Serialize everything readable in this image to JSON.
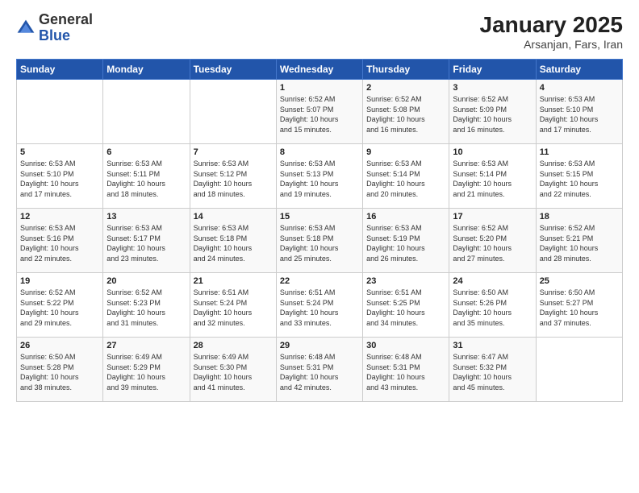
{
  "logo": {
    "general": "General",
    "blue": "Blue"
  },
  "title": "January 2025",
  "subtitle": "Arsanjan, Fars, Iran",
  "weekdays": [
    "Sunday",
    "Monday",
    "Tuesday",
    "Wednesday",
    "Thursday",
    "Friday",
    "Saturday"
  ],
  "weeks": [
    [
      {
        "day": "",
        "info": ""
      },
      {
        "day": "",
        "info": ""
      },
      {
        "day": "",
        "info": ""
      },
      {
        "day": "1",
        "info": "Sunrise: 6:52 AM\nSunset: 5:07 PM\nDaylight: 10 hours\nand 15 minutes."
      },
      {
        "day": "2",
        "info": "Sunrise: 6:52 AM\nSunset: 5:08 PM\nDaylight: 10 hours\nand 16 minutes."
      },
      {
        "day": "3",
        "info": "Sunrise: 6:52 AM\nSunset: 5:09 PM\nDaylight: 10 hours\nand 16 minutes."
      },
      {
        "day": "4",
        "info": "Sunrise: 6:53 AM\nSunset: 5:10 PM\nDaylight: 10 hours\nand 17 minutes."
      }
    ],
    [
      {
        "day": "5",
        "info": "Sunrise: 6:53 AM\nSunset: 5:10 PM\nDaylight: 10 hours\nand 17 minutes."
      },
      {
        "day": "6",
        "info": "Sunrise: 6:53 AM\nSunset: 5:11 PM\nDaylight: 10 hours\nand 18 minutes."
      },
      {
        "day": "7",
        "info": "Sunrise: 6:53 AM\nSunset: 5:12 PM\nDaylight: 10 hours\nand 18 minutes."
      },
      {
        "day": "8",
        "info": "Sunrise: 6:53 AM\nSunset: 5:13 PM\nDaylight: 10 hours\nand 19 minutes."
      },
      {
        "day": "9",
        "info": "Sunrise: 6:53 AM\nSunset: 5:14 PM\nDaylight: 10 hours\nand 20 minutes."
      },
      {
        "day": "10",
        "info": "Sunrise: 6:53 AM\nSunset: 5:14 PM\nDaylight: 10 hours\nand 21 minutes."
      },
      {
        "day": "11",
        "info": "Sunrise: 6:53 AM\nSunset: 5:15 PM\nDaylight: 10 hours\nand 22 minutes."
      }
    ],
    [
      {
        "day": "12",
        "info": "Sunrise: 6:53 AM\nSunset: 5:16 PM\nDaylight: 10 hours\nand 22 minutes."
      },
      {
        "day": "13",
        "info": "Sunrise: 6:53 AM\nSunset: 5:17 PM\nDaylight: 10 hours\nand 23 minutes."
      },
      {
        "day": "14",
        "info": "Sunrise: 6:53 AM\nSunset: 5:18 PM\nDaylight: 10 hours\nand 24 minutes."
      },
      {
        "day": "15",
        "info": "Sunrise: 6:53 AM\nSunset: 5:18 PM\nDaylight: 10 hours\nand 25 minutes."
      },
      {
        "day": "16",
        "info": "Sunrise: 6:53 AM\nSunset: 5:19 PM\nDaylight: 10 hours\nand 26 minutes."
      },
      {
        "day": "17",
        "info": "Sunrise: 6:52 AM\nSunset: 5:20 PM\nDaylight: 10 hours\nand 27 minutes."
      },
      {
        "day": "18",
        "info": "Sunrise: 6:52 AM\nSunset: 5:21 PM\nDaylight: 10 hours\nand 28 minutes."
      }
    ],
    [
      {
        "day": "19",
        "info": "Sunrise: 6:52 AM\nSunset: 5:22 PM\nDaylight: 10 hours\nand 29 minutes."
      },
      {
        "day": "20",
        "info": "Sunrise: 6:52 AM\nSunset: 5:23 PM\nDaylight: 10 hours\nand 31 minutes."
      },
      {
        "day": "21",
        "info": "Sunrise: 6:51 AM\nSunset: 5:24 PM\nDaylight: 10 hours\nand 32 minutes."
      },
      {
        "day": "22",
        "info": "Sunrise: 6:51 AM\nSunset: 5:24 PM\nDaylight: 10 hours\nand 33 minutes."
      },
      {
        "day": "23",
        "info": "Sunrise: 6:51 AM\nSunset: 5:25 PM\nDaylight: 10 hours\nand 34 minutes."
      },
      {
        "day": "24",
        "info": "Sunrise: 6:50 AM\nSunset: 5:26 PM\nDaylight: 10 hours\nand 35 minutes."
      },
      {
        "day": "25",
        "info": "Sunrise: 6:50 AM\nSunset: 5:27 PM\nDaylight: 10 hours\nand 37 minutes."
      }
    ],
    [
      {
        "day": "26",
        "info": "Sunrise: 6:50 AM\nSunset: 5:28 PM\nDaylight: 10 hours\nand 38 minutes."
      },
      {
        "day": "27",
        "info": "Sunrise: 6:49 AM\nSunset: 5:29 PM\nDaylight: 10 hours\nand 39 minutes."
      },
      {
        "day": "28",
        "info": "Sunrise: 6:49 AM\nSunset: 5:30 PM\nDaylight: 10 hours\nand 41 minutes."
      },
      {
        "day": "29",
        "info": "Sunrise: 6:48 AM\nSunset: 5:31 PM\nDaylight: 10 hours\nand 42 minutes."
      },
      {
        "day": "30",
        "info": "Sunrise: 6:48 AM\nSunset: 5:31 PM\nDaylight: 10 hours\nand 43 minutes."
      },
      {
        "day": "31",
        "info": "Sunrise: 6:47 AM\nSunset: 5:32 PM\nDaylight: 10 hours\nand 45 minutes."
      },
      {
        "day": "",
        "info": ""
      }
    ]
  ]
}
